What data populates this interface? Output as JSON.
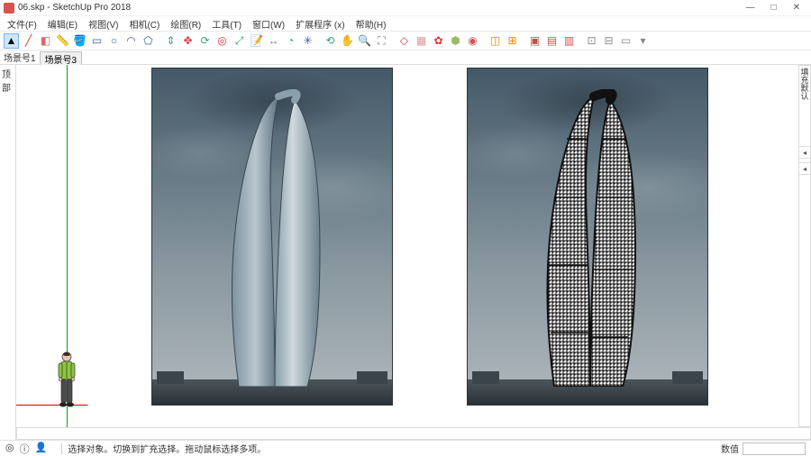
{
  "titlebar": {
    "filename": "06.skp",
    "app_name": "SketchUp Pro 2018",
    "title_sep": " - ",
    "minimize": "—",
    "maximize": "□",
    "close": "✕"
  },
  "menubar": {
    "items": [
      {
        "label": "文件(F)"
      },
      {
        "label": "编辑(E)"
      },
      {
        "label": "视图(V)"
      },
      {
        "label": "相机(C)"
      },
      {
        "label": "绘图(R)"
      },
      {
        "label": "工具(T)"
      },
      {
        "label": "窗口(W)"
      },
      {
        "label": "扩展程序 (x)"
      },
      {
        "label": "帮助(H)"
      }
    ]
  },
  "toolbar": {
    "icons": [
      {
        "name": "select-tool",
        "glyph": "▲",
        "color": "#000",
        "selected": true
      },
      {
        "name": "line-tool",
        "glyph": "╱",
        "color": "#d33"
      },
      {
        "name": "eraser-tool",
        "glyph": "◧",
        "color": "#d66"
      },
      {
        "name": "tape-measure-tool",
        "glyph": "📏",
        "color": "#cc9"
      },
      {
        "name": "paint-bucket-tool",
        "glyph": "🪣",
        "color": "#a52"
      },
      {
        "name": "rectangle-tool",
        "glyph": "▭",
        "color": "#36a"
      },
      {
        "name": "circle-tool",
        "glyph": "○",
        "color": "#36a"
      },
      {
        "name": "arc-tool",
        "glyph": "◠",
        "color": "#36a"
      },
      {
        "name": "polygon-tool",
        "glyph": "⬠",
        "color": "#36a"
      },
      {
        "name": "push-pull-tool",
        "glyph": "⇕",
        "color": "#3a7"
      },
      {
        "name": "move-tool",
        "glyph": "✥",
        "color": "#d33"
      },
      {
        "name": "rotate-tool",
        "glyph": "⟳",
        "color": "#3a7"
      },
      {
        "name": "offset-tool",
        "glyph": "◎",
        "color": "#d33"
      },
      {
        "name": "scale-tool",
        "glyph": "⤢",
        "color": "#3a7"
      },
      {
        "name": "text-tool",
        "glyph": "📝",
        "color": "#777"
      },
      {
        "name": "dimension-tool",
        "glyph": "↔",
        "color": "#777"
      },
      {
        "name": "protractor-tool",
        "glyph": "◔",
        "color": "#3a7"
      },
      {
        "name": "axes-tool",
        "glyph": "✳",
        "color": "#36a"
      },
      {
        "name": "orbit-tool",
        "glyph": "⟲",
        "color": "#3a7"
      },
      {
        "name": "pan-tool",
        "glyph": "✋",
        "color": "#e96"
      },
      {
        "name": "zoom-tool",
        "glyph": "🔍",
        "color": "#777"
      },
      {
        "name": "zoom-extents-tool",
        "glyph": "⛶",
        "color": "#777"
      },
      {
        "name": "iso-tool",
        "glyph": "◇",
        "color": "#d33"
      },
      {
        "name": "front-view-tool",
        "glyph": "▦",
        "color": "#d99"
      },
      {
        "name": "unknown-tool-1",
        "glyph": "✿",
        "color": "#d33"
      },
      {
        "name": "unknown-tool-2",
        "glyph": "⬢",
        "color": "#9b6"
      },
      {
        "name": "unknown-tool-3",
        "glyph": "◉",
        "color": "#c55"
      },
      {
        "name": "section-tool",
        "glyph": "◫",
        "color": "#e80"
      },
      {
        "name": "section-display-tool",
        "glyph": "⊞",
        "color": "#e80"
      },
      {
        "name": "plugin-tool-1",
        "glyph": "▣",
        "color": "#d44"
      },
      {
        "name": "plugin-tool-2",
        "glyph": "▤",
        "color": "#d44"
      },
      {
        "name": "plugin-tool-3",
        "glyph": "▥",
        "color": "#d44"
      },
      {
        "name": "display-mode-1",
        "glyph": "⊡",
        "color": "#888"
      },
      {
        "name": "display-mode-2",
        "glyph": "⊟",
        "color": "#888"
      },
      {
        "name": "display-mode-3",
        "glyph": "▭",
        "color": "#888"
      },
      {
        "name": "display-mode-4",
        "glyph": "▾",
        "color": "#888"
      }
    ]
  },
  "scene_tabs": {
    "label": "场景号1",
    "tabs": [
      {
        "label": "场景号3"
      }
    ]
  },
  "ruler_v_label": "顶部",
  "right_panel": {
    "label1": "填",
    "label2": "充",
    "label3": "默",
    "label4": "认"
  },
  "status": {
    "hint": "选择对象。切换到扩充选择。拖动鼠标选择多项。",
    "vcb_label": "数值",
    "icons": [
      {
        "name": "geolocation-status-icon",
        "glyph": "◎"
      },
      {
        "name": "credits-status-icon",
        "glyph": "ⓘ"
      },
      {
        "name": "claim-status-icon",
        "glyph": "👤"
      }
    ]
  },
  "colors": {
    "axis_green": "#00a000",
    "axis_red": "#d00000"
  }
}
